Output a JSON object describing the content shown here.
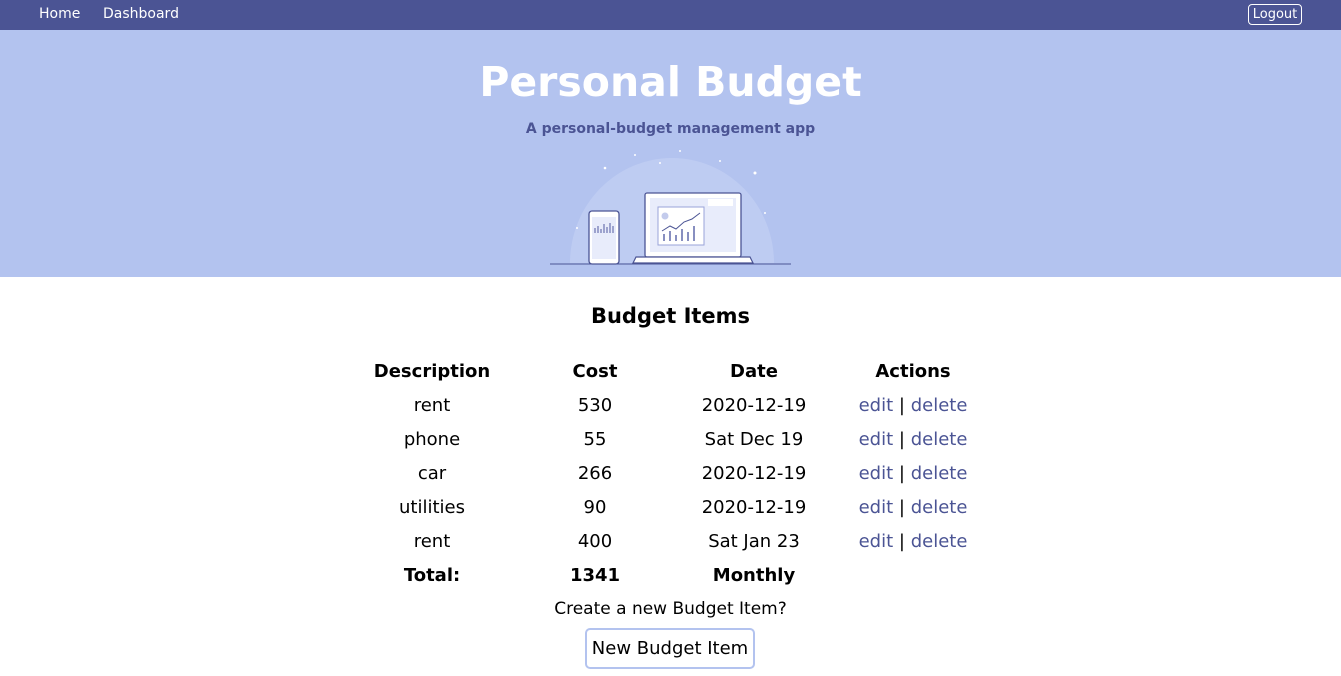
{
  "nav": {
    "home": "Home",
    "dashboard": "Dashboard",
    "logout": "Logout"
  },
  "hero": {
    "title": "Personal Budget",
    "subtitle": "A personal-budget management app"
  },
  "budget": {
    "title": "Budget Items",
    "headers": [
      "Description",
      "Cost",
      "Date",
      "Actions"
    ],
    "rows": [
      {
        "description": "rent",
        "cost": "530",
        "date": "2020-12-19"
      },
      {
        "description": "phone",
        "cost": "55",
        "date": "Sat Dec 19"
      },
      {
        "description": "car",
        "cost": "266",
        "date": "2020-12-19"
      },
      {
        "description": "utilities",
        "cost": "90",
        "date": "2020-12-19"
      },
      {
        "description": "rent",
        "cost": "400",
        "date": "Sat Jan 23"
      }
    ],
    "actions": {
      "edit": "edit",
      "separator": "|",
      "delete": "delete"
    },
    "total": {
      "label": "Total:",
      "value": "1341",
      "period": "Monthly"
    }
  },
  "create": {
    "prompt": "Create a new Budget Item?",
    "button": "New Budget Item"
  },
  "colors": {
    "nav_bg": "#4b5494",
    "hero_bg": "#b3c3ef",
    "link": "#4b5494"
  }
}
